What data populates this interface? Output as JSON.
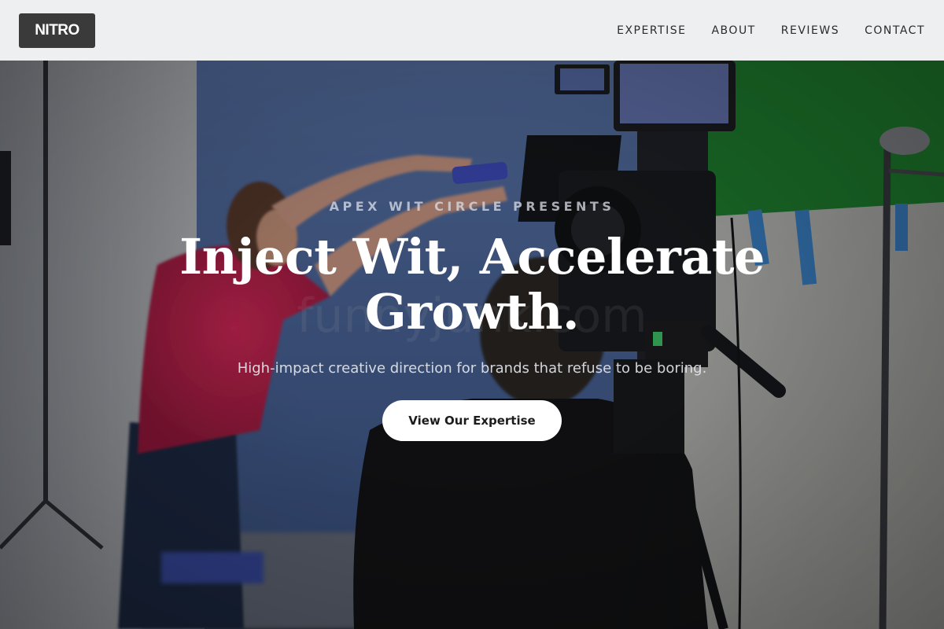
{
  "header": {
    "logo": "NITRO",
    "nav": [
      {
        "label": "EXPERTISE"
      },
      {
        "label": "ABOUT"
      },
      {
        "label": "REVIEWS"
      },
      {
        "label": "CONTACT"
      }
    ]
  },
  "hero": {
    "eyebrow": "APEX WIT CIRCLE PRESENTS",
    "headline": "Inject Wit, Accelerate Growth.",
    "subhead": "High-impact creative direction for brands that refuse to be boring.",
    "cta_label": "View Our Expertise",
    "background": "film-set-photo"
  },
  "colors": {
    "header_bg": "#eeeff0",
    "logo_bg": "#3a3a3a",
    "cta_bg": "#ffffff",
    "backdrop_blue": "#5270a8",
    "green_screen": "#1f8a2e"
  }
}
